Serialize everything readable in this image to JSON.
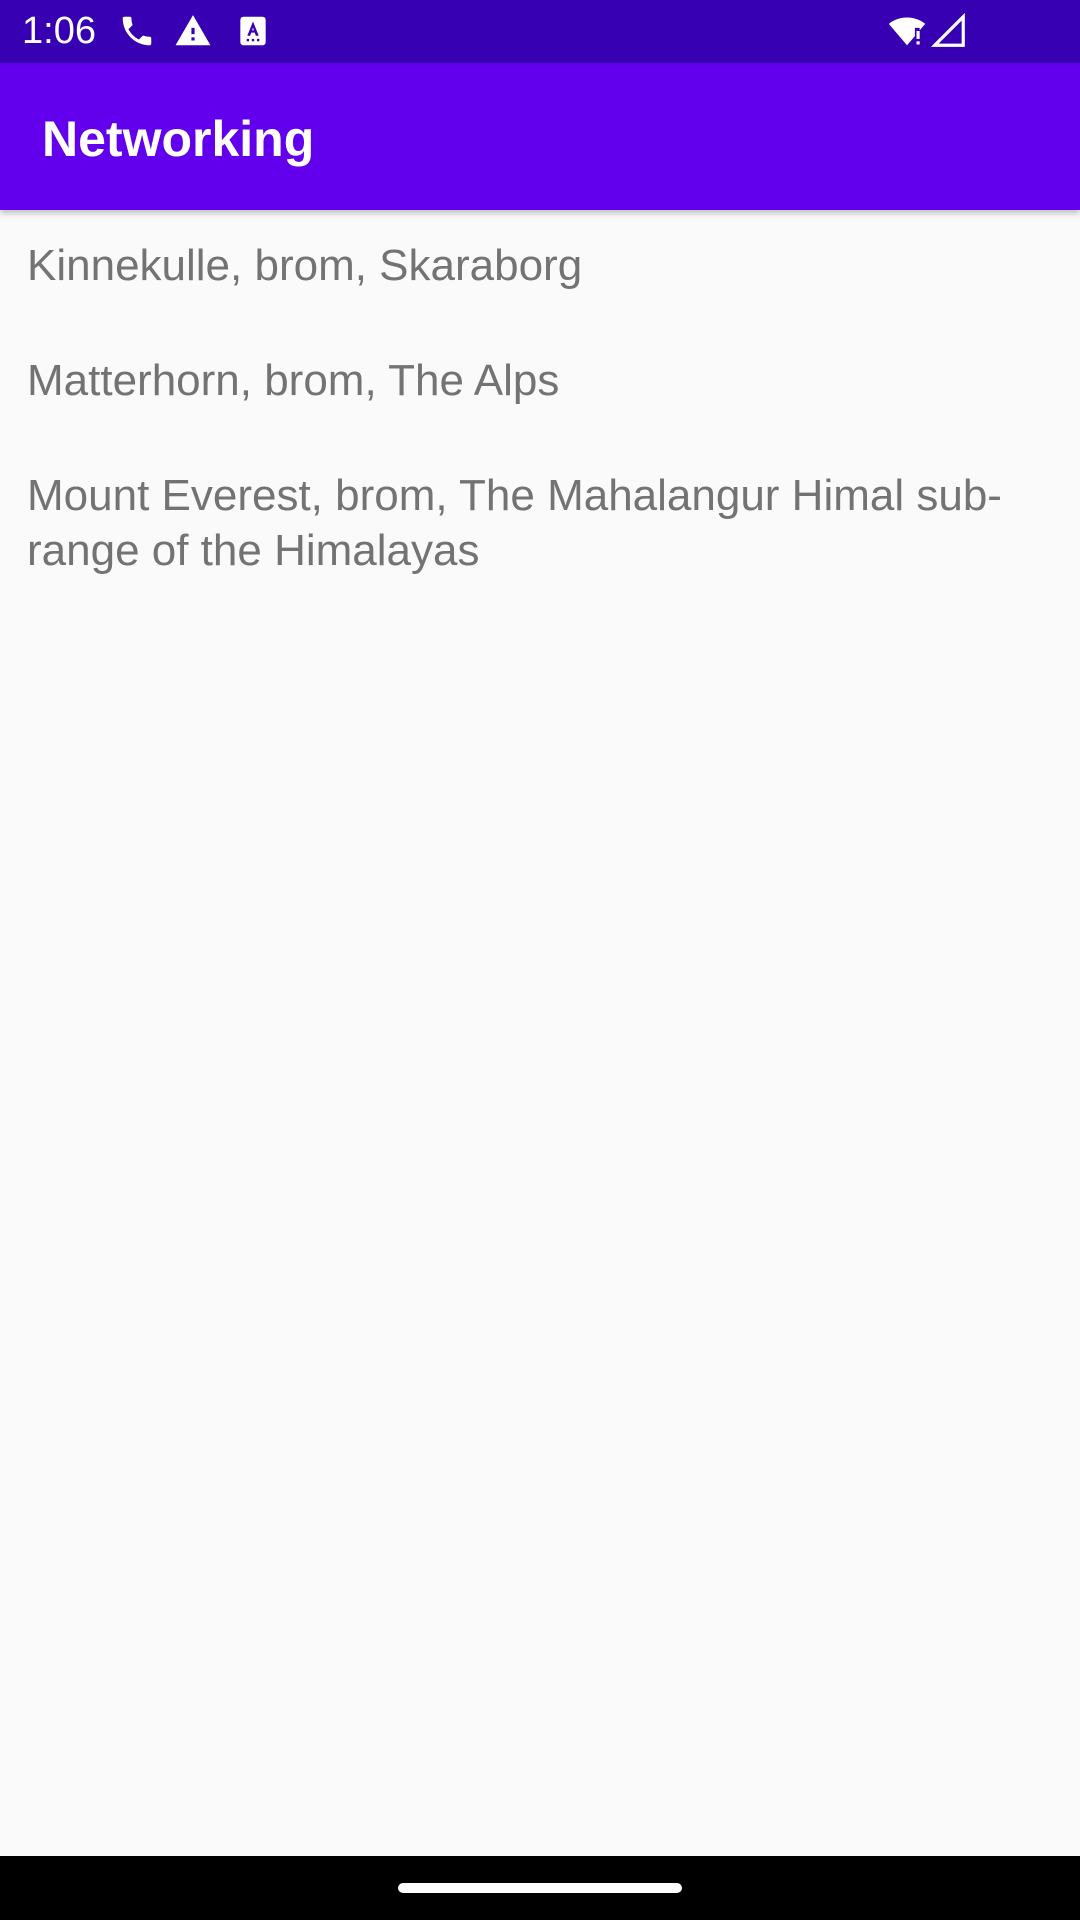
{
  "status_bar": {
    "time": "1:06",
    "icons": [
      "phone-icon",
      "warning-icon",
      "keyboard-a-icon",
      "wifi-alert-icon",
      "signal-icon"
    ]
  },
  "app_bar": {
    "title": "Networking"
  },
  "list": {
    "items": [
      {
        "text": "Kinnekulle, brom, Skaraborg"
      },
      {
        "text": "Matterhorn, brom, The Alps"
      },
      {
        "text": "Mount Everest, brom, The Mahalangur Himal sub-range of the Himalayas"
      }
    ]
  },
  "colors": {
    "status_bar": "#3700b3",
    "app_bar": "#6200ee",
    "background": "#fafafa",
    "item_text": "#737373",
    "nav_bar": "#000000"
  }
}
